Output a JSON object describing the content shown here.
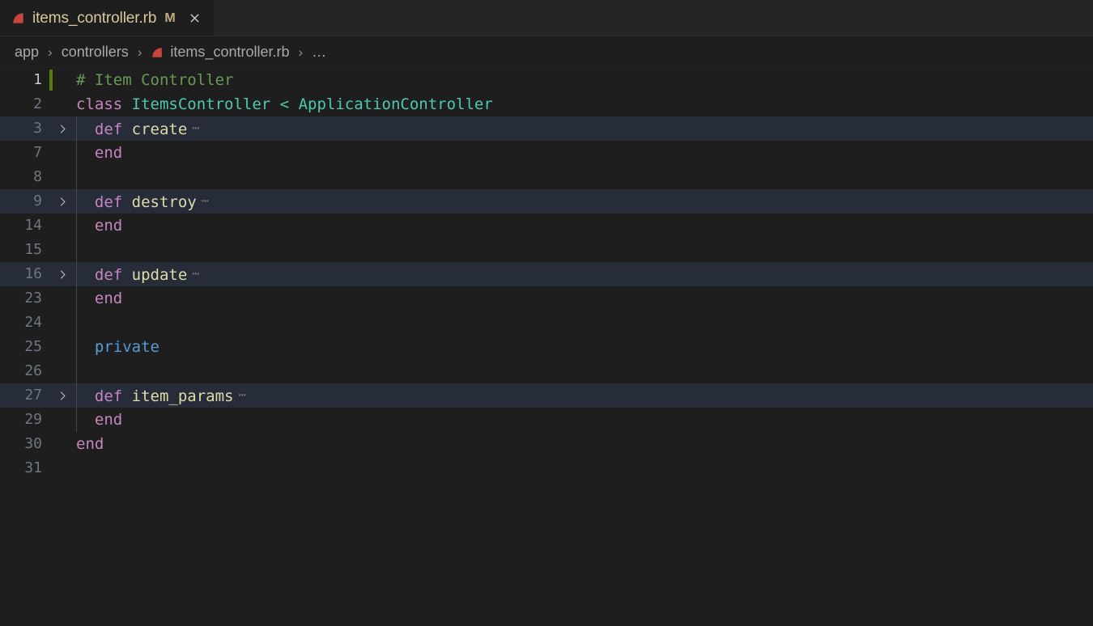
{
  "window": {
    "app": "vscode-editor"
  },
  "tab": {
    "filename": "items_controller.rb",
    "dirty_badge": "M",
    "icon": "ruby-file-icon",
    "close_icon": "close-icon",
    "active": true
  },
  "breadcrumbs": {
    "separator": "›",
    "items": [
      {
        "label": "app",
        "icon": null
      },
      {
        "label": "controllers",
        "icon": null
      },
      {
        "label": "items_controller.rb",
        "icon": "ruby-file-icon"
      },
      {
        "label": "…",
        "icon": null
      }
    ]
  },
  "editor": {
    "language": "ruby",
    "fold_marker": "⋯",
    "active_line": 1,
    "lines": [
      {
        "number": "1",
        "foldable": false,
        "folded": false,
        "git_added": true,
        "active": true,
        "has_squiggle": true,
        "indent_guides": 0,
        "tokens": [
          {
            "text": "# Item Controller",
            "cls": "t-comment"
          }
        ]
      },
      {
        "number": "2",
        "foldable": false,
        "folded": false,
        "git_added": false,
        "active": false,
        "has_squiggle": false,
        "indent_guides": 0,
        "tokens": [
          {
            "text": "class ",
            "cls": "t-keyword"
          },
          {
            "text": "ItemsController ",
            "cls": "t-type"
          },
          {
            "text": "< ",
            "cls": "t-op"
          },
          {
            "text": "ApplicationController",
            "cls": "t-type"
          }
        ]
      },
      {
        "number": "3",
        "foldable": true,
        "folded": true,
        "git_added": false,
        "active": false,
        "has_squiggle": false,
        "indent_guides": 1,
        "tokens": [
          {
            "text": "  def ",
            "cls": "t-keyword"
          },
          {
            "text": "create",
            "cls": "t-func"
          }
        ]
      },
      {
        "number": "7",
        "foldable": false,
        "folded": false,
        "git_added": false,
        "active": false,
        "has_squiggle": false,
        "indent_guides": 1,
        "tokens": [
          {
            "text": "  end",
            "cls": "t-keyword"
          }
        ]
      },
      {
        "number": "8",
        "foldable": false,
        "folded": false,
        "git_added": false,
        "active": false,
        "has_squiggle": false,
        "indent_guides": 1,
        "tokens": []
      },
      {
        "number": "9",
        "foldable": true,
        "folded": true,
        "git_added": false,
        "active": false,
        "has_squiggle": false,
        "indent_guides": 1,
        "tokens": [
          {
            "text": "  def ",
            "cls": "t-keyword"
          },
          {
            "text": "destroy",
            "cls": "t-func"
          }
        ]
      },
      {
        "number": "14",
        "foldable": false,
        "folded": false,
        "git_added": false,
        "active": false,
        "has_squiggle": false,
        "indent_guides": 1,
        "tokens": [
          {
            "text": "  end",
            "cls": "t-keyword"
          }
        ]
      },
      {
        "number": "15",
        "foldable": false,
        "folded": false,
        "git_added": false,
        "active": false,
        "has_squiggle": false,
        "indent_guides": 1,
        "tokens": []
      },
      {
        "number": "16",
        "foldable": true,
        "folded": true,
        "git_added": false,
        "active": false,
        "has_squiggle": false,
        "indent_guides": 1,
        "tokens": [
          {
            "text": "  def ",
            "cls": "t-keyword"
          },
          {
            "text": "update",
            "cls": "t-func"
          }
        ]
      },
      {
        "number": "23",
        "foldable": false,
        "folded": false,
        "git_added": false,
        "active": false,
        "has_squiggle": false,
        "indent_guides": 1,
        "tokens": [
          {
            "text": "  end",
            "cls": "t-keyword"
          }
        ]
      },
      {
        "number": "24",
        "foldable": false,
        "folded": false,
        "git_added": false,
        "active": false,
        "has_squiggle": false,
        "indent_guides": 1,
        "tokens": []
      },
      {
        "number": "25",
        "foldable": false,
        "folded": false,
        "git_added": false,
        "active": false,
        "has_squiggle": false,
        "indent_guides": 1,
        "tokens": [
          {
            "text": "  private",
            "cls": "t-control"
          }
        ]
      },
      {
        "number": "26",
        "foldable": false,
        "folded": false,
        "git_added": false,
        "active": false,
        "has_squiggle": false,
        "indent_guides": 1,
        "tokens": []
      },
      {
        "number": "27",
        "foldable": true,
        "folded": true,
        "git_added": false,
        "active": false,
        "has_squiggle": false,
        "indent_guides": 1,
        "tokens": [
          {
            "text": "  def ",
            "cls": "t-keyword"
          },
          {
            "text": "item_params",
            "cls": "t-func"
          }
        ]
      },
      {
        "number": "29",
        "foldable": false,
        "folded": false,
        "git_added": false,
        "active": false,
        "has_squiggle": false,
        "indent_guides": 1,
        "tokens": [
          {
            "text": "  end",
            "cls": "t-keyword"
          }
        ]
      },
      {
        "number": "30",
        "foldable": false,
        "folded": false,
        "git_added": false,
        "active": false,
        "has_squiggle": false,
        "indent_guides": 0,
        "tokens": [
          {
            "text": "end",
            "cls": "t-keyword"
          }
        ]
      },
      {
        "number": "31",
        "foldable": false,
        "folded": false,
        "git_added": false,
        "active": false,
        "has_squiggle": false,
        "indent_guides": 0,
        "tokens": []
      }
    ]
  },
  "colors": {
    "editor_background": "#1e1e1e",
    "tabbar_background": "#252526",
    "folded_line_background": "#262c38",
    "comment": "#6a9955",
    "keyword": "#c586c0",
    "type": "#4ec9b0",
    "function": "#dcdcaa",
    "control": "#569cd6",
    "linenumber": "#6e7681",
    "git_added": "#587c0c",
    "ruby_icon": "#c8453c",
    "dirty_badge": "#c0ad7e"
  }
}
